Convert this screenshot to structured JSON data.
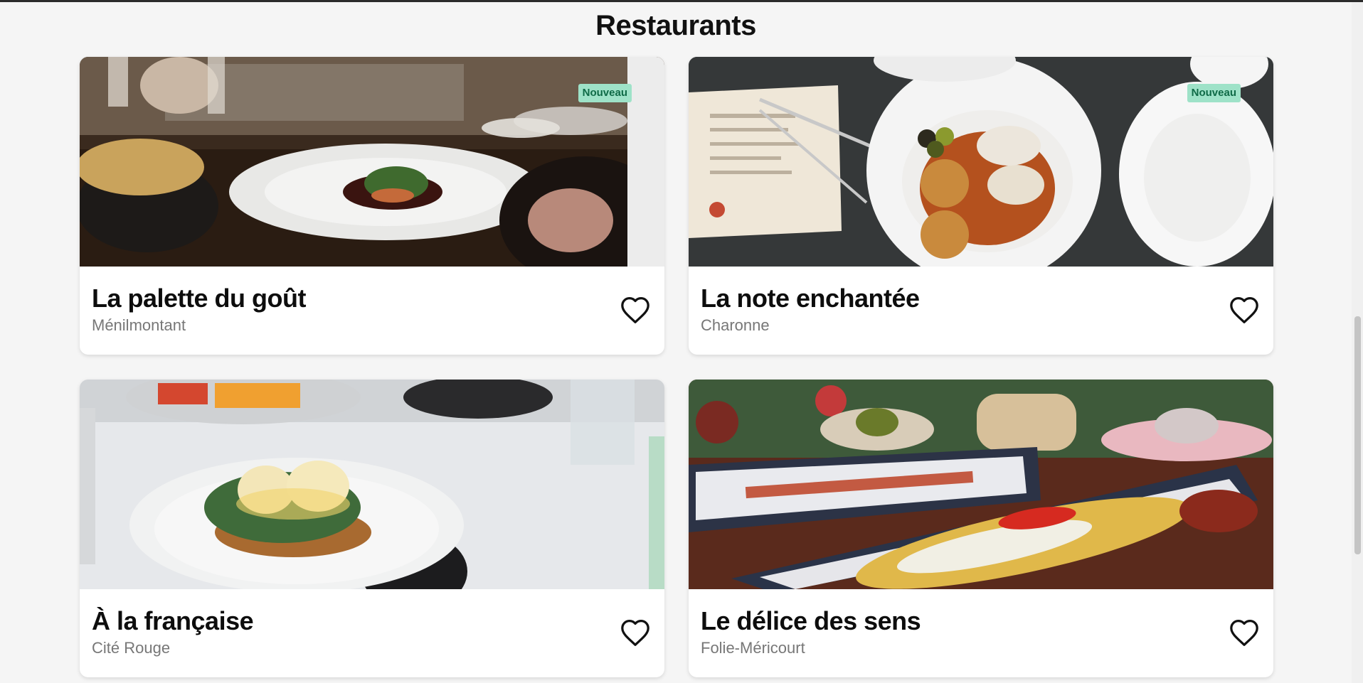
{
  "page": {
    "title": "Restaurants"
  },
  "restaurants": [
    {
      "name": "La palette du goût",
      "area": "Ménilmontant",
      "badge": "Nouveau",
      "image": "plated-dish-table-scene",
      "favorite": false
    },
    {
      "name": "La note enchantée",
      "area": "Charonne",
      "badge": "Nouveau",
      "image": "top-view-plates-menu",
      "favorite": false
    },
    {
      "name": "À la française",
      "area": "Cité Rouge",
      "badge": "",
      "image": "eggs-benedict-plate",
      "favorite": false
    },
    {
      "name": "Le délice des sens",
      "area": "Folie-Méricourt",
      "badge": "",
      "image": "long-fish-platters",
      "favorite": false
    }
  ],
  "icons": {
    "favorite": "heart-outline-icon"
  },
  "colors": {
    "badge_bg": "#9ee2c8",
    "badge_text": "#0f6a47",
    "background": "#f5f5f5"
  }
}
